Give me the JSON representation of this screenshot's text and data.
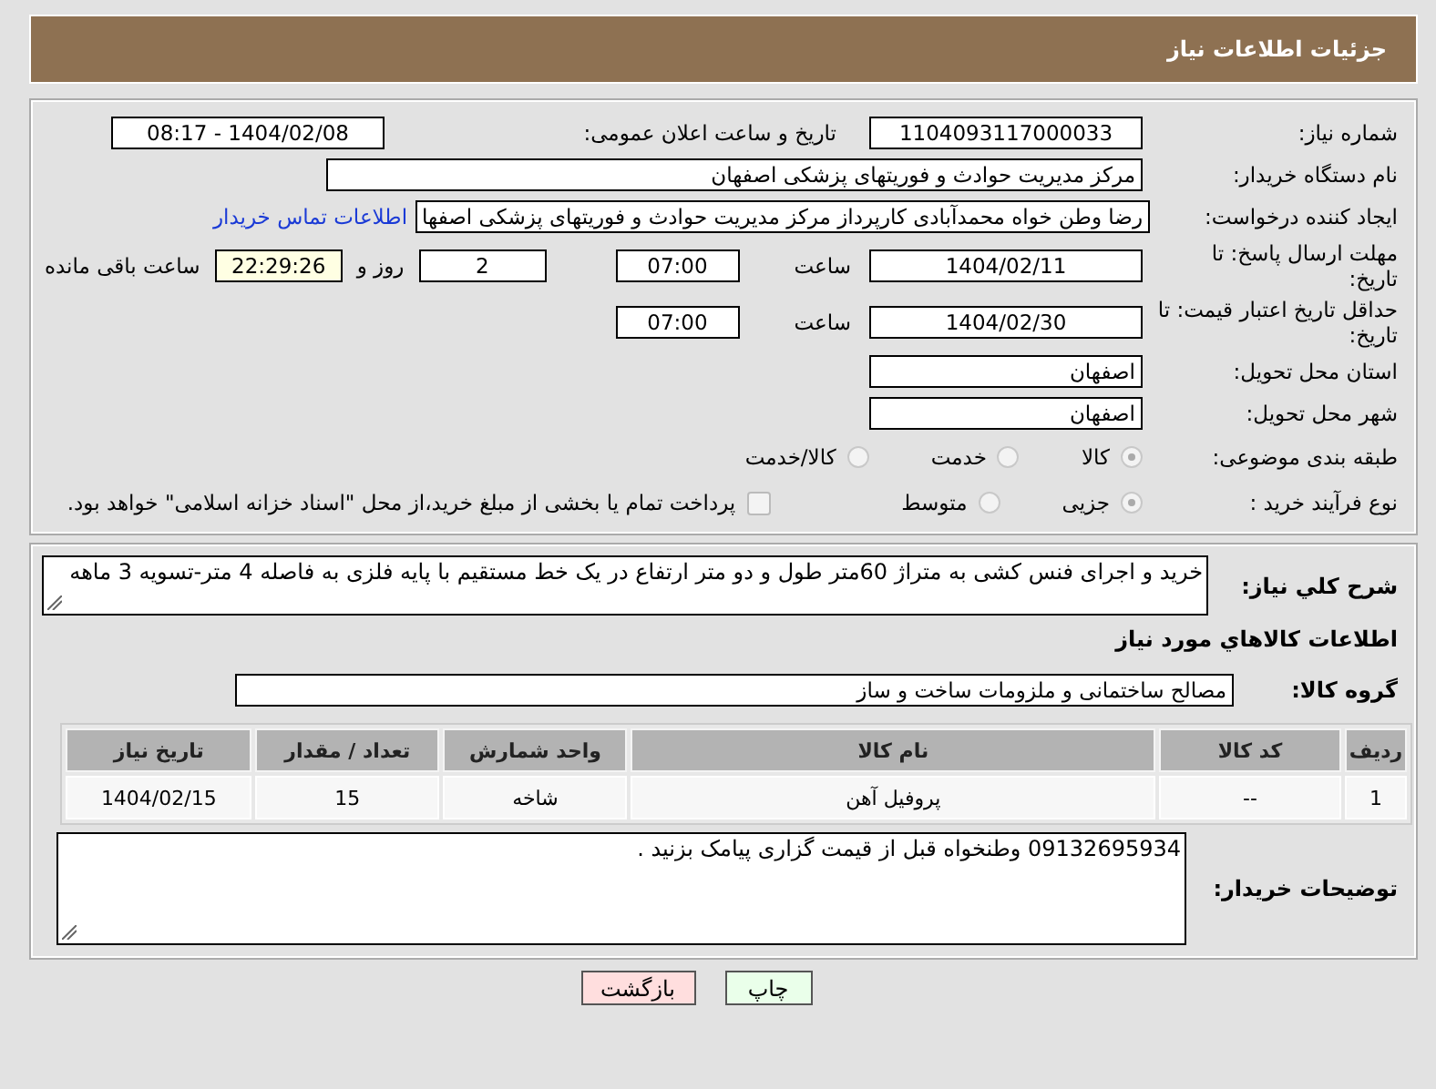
{
  "header": {
    "title": "جزئیات اطلاعات نیاز"
  },
  "need_number": {
    "label": "شماره نیاز:",
    "value": "1104093117000033"
  },
  "announce_datetime": {
    "label": "تاریخ و ساعت اعلان عمومی:",
    "value": "1404/02/08 - 08:17"
  },
  "buyer_org": {
    "label": "نام دستگاه خریدار:",
    "value": "مرکز مدیریت حوادث و فوریتهای پزشکی اصفهان"
  },
  "requester": {
    "label": "ایجاد کننده درخواست:",
    "value": "رضا وطن خواه محمدآبادی کارپرداز مرکز مدیریت حوادث و فوریتهای پزشکی اصفها",
    "link": "اطلاعات تماس خریدار"
  },
  "reply_deadline": {
    "label": "مهلت ارسال پاسخ: تا تاریخ:",
    "date": "1404/02/11",
    "time_label": "ساعت",
    "time": "07:00",
    "days": "2",
    "days_label": "روز و",
    "remaining": "22:29:26",
    "remaining_label": "ساعت باقی مانده"
  },
  "price_validity": {
    "label": "حداقل تاریخ اعتبار قیمت: تا تاریخ:",
    "date": "1404/02/30",
    "time_label": "ساعت",
    "time": "07:00"
  },
  "province": {
    "label": "استان محل تحویل:",
    "value": "اصفهان"
  },
  "city": {
    "label": "شهر محل تحویل:",
    "value": "اصفهان"
  },
  "category": {
    "label": "طبقه بندی موضوعی:",
    "options": [
      {
        "label": "کالا",
        "selected": true
      },
      {
        "label": "خدمت",
        "selected": false
      },
      {
        "label": "کالا/خدمت",
        "selected": false
      }
    ]
  },
  "process": {
    "label": "نوع فرآیند خرید :",
    "options": [
      {
        "label": "جزیی",
        "selected": true
      },
      {
        "label": "متوسط",
        "selected": false
      }
    ],
    "treasury": {
      "label": "پرداخت تمام یا بخشی از مبلغ خرید،از محل \"اسناد خزانه اسلامی\" خواهد بود.",
      "checked": false
    }
  },
  "description": {
    "label": "شرح کلي نياز:",
    "value": "خرید و اجرای فنس کشی به متراژ 60متر طول و دو متر ارتفاع در یک خط مستقیم با پایه فلزی به فاصله 4 متر-تسویه 3 ماهه"
  },
  "goods_heading": "اطلاعات کالاهاي مورد نياز",
  "goods_group": {
    "label": "گروه کالا:",
    "value": "مصالح ساختمانی و ملزومات ساخت و ساز"
  },
  "table": {
    "columns": [
      "ردیف",
      "کد کالا",
      "نام کالا",
      "واحد شمارش",
      "تعداد / مقدار",
      "تاریخ نیاز"
    ],
    "rows": [
      [
        "1",
        "--",
        "پروفیل آهن",
        "شاخه",
        "15",
        "1404/02/15"
      ]
    ]
  },
  "buyer_notes": {
    "label": "توضیحات خریدار:",
    "value": "09132695934  وطنخواه قبل از قیمت گزاری پیامک بزنید ."
  },
  "buttons": [
    {
      "label": "چاپ",
      "kind": "print"
    },
    {
      "label": "بازگشت",
      "kind": "back"
    }
  ]
}
